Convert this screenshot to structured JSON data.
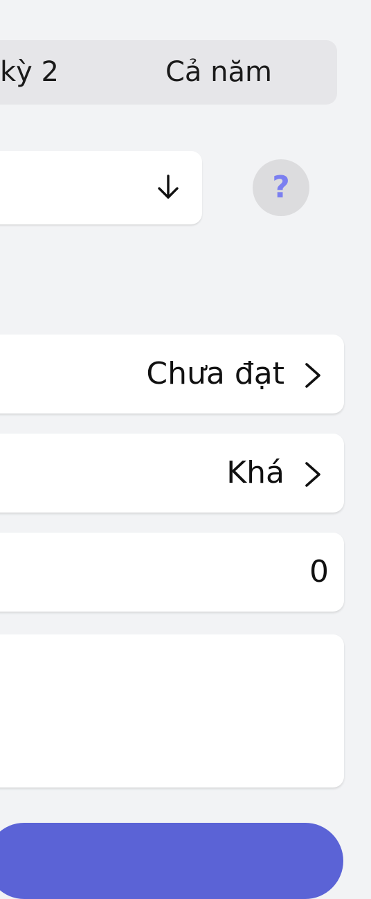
{
  "segment": {
    "term2_label": "kỳ 2",
    "year_label": "Cả năm",
    "selected": "Cả năm"
  },
  "dropdown": {
    "icon": "arrow-down-icon"
  },
  "help": {
    "label": "?",
    "color": "#7b7ff0"
  },
  "rows": [
    {
      "value": "Chưa đạt",
      "icon": "chevron-right-icon"
    },
    {
      "value": "Khá",
      "icon": "chevron-right-icon"
    },
    {
      "value": "0"
    },
    {
      "value": ""
    }
  ],
  "colors": {
    "background": "#f2f3f5",
    "accent": "#5b63d6",
    "segment_bg": "#e6e6e9"
  }
}
